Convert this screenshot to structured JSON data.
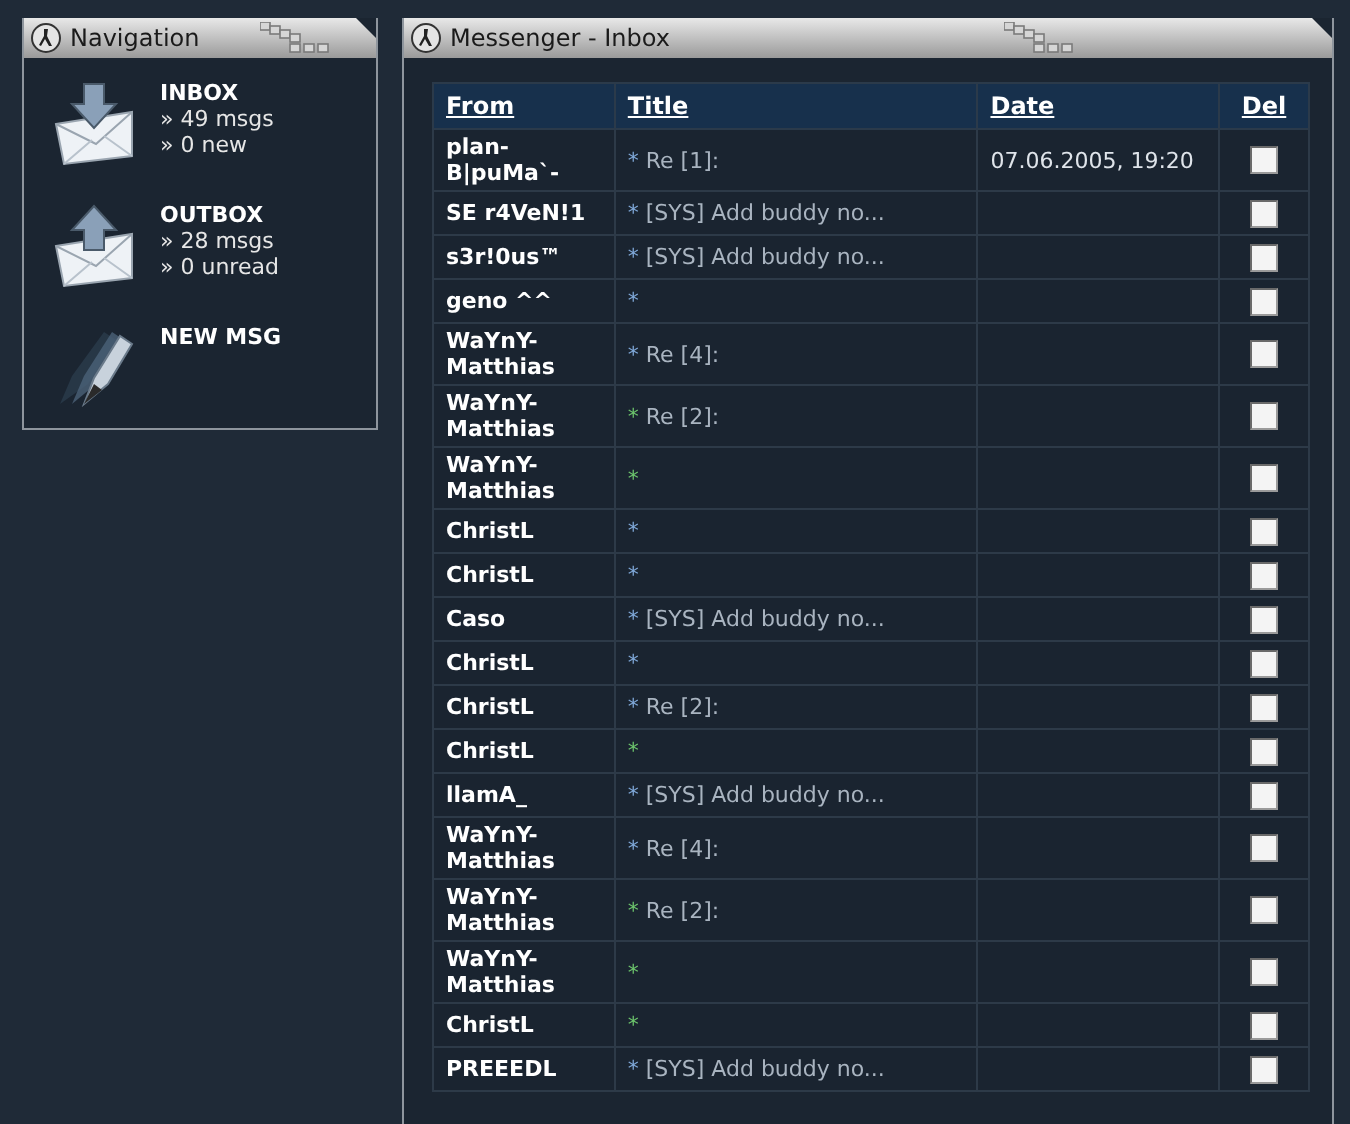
{
  "navigation": {
    "title": "Navigation",
    "items": [
      {
        "kind": "inbox",
        "label": "INBOX",
        "lines": [
          "» 49 msgs",
          "» 0 new"
        ]
      },
      {
        "kind": "outbox",
        "label": "OUTBOX",
        "lines": [
          "» 28 msgs",
          "» 0 unread"
        ]
      },
      {
        "kind": "compose",
        "label": "NEW MSG"
      }
    ]
  },
  "inbox": {
    "title": "Messenger - Inbox",
    "columns": [
      "From",
      "Title",
      "Date",
      "Del"
    ],
    "messages": [
      {
        "from": "plan-B|puMa`-",
        "marker": "*",
        "title": "Re [1]:",
        "date": "07.06.2005, 19:20",
        "color": "#7fa8d8",
        "checked": false
      },
      {
        "from": "SE r4VeN!1",
        "marker": "*",
        "title": "[SYS] Add buddy no...",
        "color": "#7fa8d8",
        "checked": false
      },
      {
        "from": "s3r!0us™",
        "marker": "*",
        "title": "[SYS] Add buddy no...",
        "color": "#7fa8d8",
        "checked": false
      },
      {
        "from": "geno ^^",
        "marker": "*",
        "color": "#7fa8d8",
        "checked": false
      },
      {
        "from": "WaYnY-Matthias",
        "marker": "*",
        "title": "Re [4]:",
        "color": "#7fa8d8",
        "checked": false
      },
      {
        "from": "WaYnY-Matthias",
        "marker": "*",
        "title": "Re [2]:",
        "color": "#6cc46c",
        "checked": false
      },
      {
        "from": "WaYnY-Matthias",
        "marker": "*",
        "color": "#6cc46c",
        "checked": false
      },
      {
        "from": "ChristL",
        "marker": "*",
        "color": "#7fa8d8",
        "checked": false
      },
      {
        "from": "ChristL",
        "marker": "*",
        "color": "#7fa8d8",
        "checked": false
      },
      {
        "from": "Caso",
        "marker": "*",
        "title": "[SYS] Add buddy no...",
        "color": "#7fa8d8",
        "checked": false
      },
      {
        "from": "ChristL",
        "marker": "*",
        "color": "#7fa8d8",
        "checked": false
      },
      {
        "from": "ChristL",
        "marker": "*",
        "title": "Re [2]:",
        "color": "#7fa8d8",
        "checked": false
      },
      {
        "from": "ChristL",
        "marker": "*",
        "color": "#6cc46c",
        "checked": false
      },
      {
        "from": "llamA_",
        "marker": "*",
        "title": "[SYS] Add buddy no...",
        "color": "#7fa8d8",
        "checked": false
      },
      {
        "from": "WaYnY-Matthias",
        "marker": "*",
        "title": "Re [4]:",
        "color": "#7fa8d8",
        "checked": false
      },
      {
        "from": "WaYnY-Matthias",
        "marker": "*",
        "title": "Re [2]:",
        "color": "#6cc46c",
        "checked": false
      },
      {
        "from": "WaYnY-Matthias",
        "marker": "*",
        "color": "#6cc46c",
        "checked": false
      },
      {
        "from": "ChristL",
        "marker": "*",
        "color": "#6cc46c",
        "checked": false
      },
      {
        "from": "PREEEDL",
        "marker": "*",
        "title": "[SYS] Add buddy no...",
        "color": "#7fa8d8",
        "checked": false
      }
    ]
  }
}
